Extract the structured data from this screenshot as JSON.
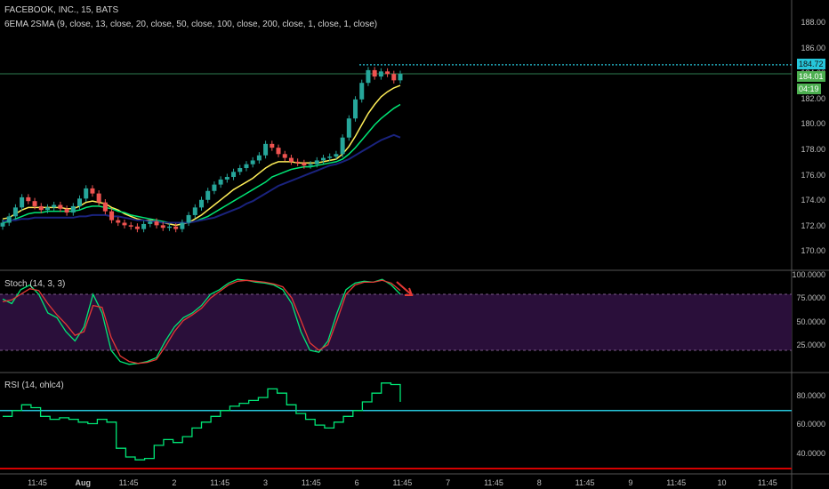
{
  "header": {
    "symbol_line": "FACEBOOK, INC., 15, BATS",
    "indicator_line": "6EMA 2SMA (9, close, 13, close, 20, close, 50, close, 100, close, 200, close, 1, close, 1, close)"
  },
  "panes": {
    "stoch_title": "Stoch (14, 3, 3)",
    "rsi_title": "RSI (14, ohlc4)"
  },
  "price_tags": {
    "high": "184.72",
    "last": "184.01",
    "countdown": "04:19"
  },
  "colors": {
    "background": "#000000",
    "up_candle": "#26a69a",
    "down_candle": "#ef5350",
    "ema_fast": "#ffee58",
    "ema_mid": "#00e676",
    "ema_slow": "#1a237e",
    "stoch_k": "#00e676",
    "stoch_d": "#e53935",
    "stoch_band": "#2a0f3a",
    "rsi_line": "#00e676",
    "rsi_level_hi": "#26c6da",
    "rsi_level_lo": "#d50000",
    "high_line": "#26c6da",
    "annotation_arrow": "#e53935"
  },
  "chart_data": [
    {
      "type": "candlestick",
      "title": "FACEBOOK, INC., 15, BATS",
      "y_axis_ticks": [
        "188.00",
        "186.00",
        "184.00",
        "182.00",
        "180.00",
        "178.00",
        "176.00",
        "174.00",
        "172.00",
        "170.00"
      ],
      "ylim": [
        169.0,
        189.0
      ],
      "x_ticks": [
        "11:45",
        "Aug",
        "11:45",
        "2",
        "11:45",
        "3",
        "11:45",
        "6",
        "11:45",
        "7",
        "11:45",
        "8",
        "11:45",
        "9",
        "11:45",
        "10",
        "11:45"
      ],
      "last_price": 184.01,
      "session_high": 184.72,
      "close_series": [
        172.3,
        172.8,
        173.5,
        174.3,
        174.0,
        173.6,
        173.3,
        173.5,
        173.7,
        173.4,
        173.1,
        173.6,
        174.2,
        175.0,
        174.6,
        173.9,
        173.2,
        172.5,
        172.3,
        172.1,
        172.0,
        171.8,
        172.2,
        172.4,
        172.1,
        171.9,
        172.0,
        171.8,
        172.3,
        172.9,
        173.5,
        174.1,
        174.8,
        175.3,
        175.7,
        175.9,
        176.3,
        176.6,
        176.9,
        177.2,
        177.6,
        178.5,
        178.2,
        177.7,
        177.4,
        177.1,
        177.0,
        176.8,
        176.9,
        177.2,
        177.4,
        177.5,
        177.7,
        179.0,
        180.5,
        182.0,
        183.3,
        184.3,
        183.8,
        184.2,
        184.0,
        183.5,
        184.01
      ],
      "series": [
        {
          "name": "EMA 9",
          "values": [
            172.6,
            172.7,
            173.0,
            173.3,
            173.5,
            173.5,
            173.5,
            173.5,
            173.5,
            173.5,
            173.4,
            173.4,
            173.6,
            173.9,
            174.0,
            173.9,
            173.8,
            173.5,
            173.3,
            173.0,
            172.8,
            172.6,
            172.5,
            172.5,
            172.4,
            172.3,
            172.2,
            172.1,
            172.2,
            172.3,
            172.6,
            172.9,
            173.3,
            173.7,
            174.1,
            174.5,
            174.9,
            175.2,
            175.5,
            175.8,
            176.2,
            176.6,
            176.9,
            177.1,
            177.1,
            177.1,
            177.0,
            177.0,
            177.0,
            177.0,
            177.1,
            177.2,
            177.3,
            177.7,
            178.3,
            179.1,
            180.0,
            180.9,
            181.6,
            182.2,
            182.6,
            182.9,
            183.1
          ]
        },
        {
          "name": "EMA 20",
          "values": [
            172.3,
            172.4,
            172.6,
            172.8,
            173.0,
            173.1,
            173.1,
            173.2,
            173.2,
            173.2,
            173.2,
            173.2,
            173.3,
            173.5,
            173.6,
            173.6,
            173.5,
            173.4,
            173.2,
            173.1,
            172.9,
            172.8,
            172.7,
            172.6,
            172.5,
            172.4,
            172.3,
            172.3,
            172.3,
            172.3,
            172.4,
            172.6,
            172.8,
            173.1,
            173.4,
            173.7,
            174.0,
            174.3,
            174.6,
            174.9,
            175.2,
            175.5,
            175.9,
            176.1,
            176.3,
            176.5,
            176.6,
            176.7,
            176.7,
            176.8,
            176.9,
            177.0,
            177.1,
            177.3,
            177.7,
            178.2,
            178.8,
            179.4,
            180.0,
            180.5,
            180.9,
            181.3,
            181.6
          ]
        },
        {
          "name": "EMA 50",
          "values": [
            172.4,
            172.5,
            172.5,
            172.6,
            172.6,
            172.7,
            172.7,
            172.7,
            172.7,
            172.7,
            172.7,
            172.7,
            172.8,
            172.8,
            172.9,
            172.9,
            172.9,
            172.8,
            172.8,
            172.7,
            172.6,
            172.5,
            172.5,
            172.4,
            172.4,
            172.3,
            172.3,
            172.3,
            172.3,
            172.3,
            172.4,
            172.5,
            172.6,
            172.7,
            172.9,
            173.1,
            173.3,
            173.5,
            173.8,
            174.0,
            174.3,
            174.6,
            174.9,
            175.2,
            175.4,
            175.6,
            175.8,
            176.0,
            176.2,
            176.4,
            176.6,
            176.8,
            176.9,
            177.1,
            177.3,
            177.6,
            177.9,
            178.2,
            178.5,
            178.8,
            179.0,
            179.2,
            179.0
          ]
        }
      ]
    },
    {
      "type": "line",
      "title": "Stoch (14, 3, 3)",
      "y_axis_ticks": [
        "100.0000",
        "75.0000",
        "50.0000",
        "25.0000"
      ],
      "ylim": [
        0,
        100
      ],
      "bands": [
        20,
        80
      ],
      "series": [
        {
          "name": "%K",
          "values": [
            75,
            70,
            85,
            90,
            80,
            60,
            55,
            40,
            30,
            45,
            80,
            60,
            20,
            8,
            5,
            6,
            8,
            12,
            30,
            45,
            55,
            60,
            68,
            80,
            85,
            92,
            96,
            95,
            93,
            92,
            90,
            85,
            70,
            40,
            20,
            18,
            30,
            60,
            85,
            92,
            94,
            93,
            96,
            90,
            80
          ]
        },
        {
          "name": "%D",
          "values": [
            72,
            74,
            80,
            86,
            84,
            70,
            58,
            48,
            36,
            40,
            68,
            66,
            34,
            14,
            8,
            6,
            7,
            10,
            24,
            40,
            52,
            58,
            65,
            76,
            83,
            90,
            94,
            95,
            94,
            93,
            91,
            88,
            76,
            52,
            28,
            20,
            26,
            52,
            80,
            90,
            93,
            93,
            95,
            92,
            84
          ]
        }
      ],
      "annotation": "arrow-down"
    },
    {
      "type": "line",
      "title": "RSI (14, ohlc4)",
      "y_axis_ticks": [
        "80.0000",
        "60.0000",
        "40.0000"
      ],
      "ylim": [
        30,
        92
      ],
      "levels": [
        70,
        30
      ],
      "series": [
        {
          "name": "RSI",
          "values": [
            66,
            70,
            74,
            72,
            66,
            64,
            65,
            64,
            62,
            61,
            64,
            62,
            44,
            38,
            36,
            37,
            46,
            50,
            48,
            52,
            58,
            62,
            66,
            70,
            73,
            75,
            77,
            79,
            85,
            82,
            74,
            68,
            64,
            60,
            58,
            62,
            66,
            70,
            76,
            82,
            89,
            88,
            76
          ]
        }
      ]
    }
  ]
}
